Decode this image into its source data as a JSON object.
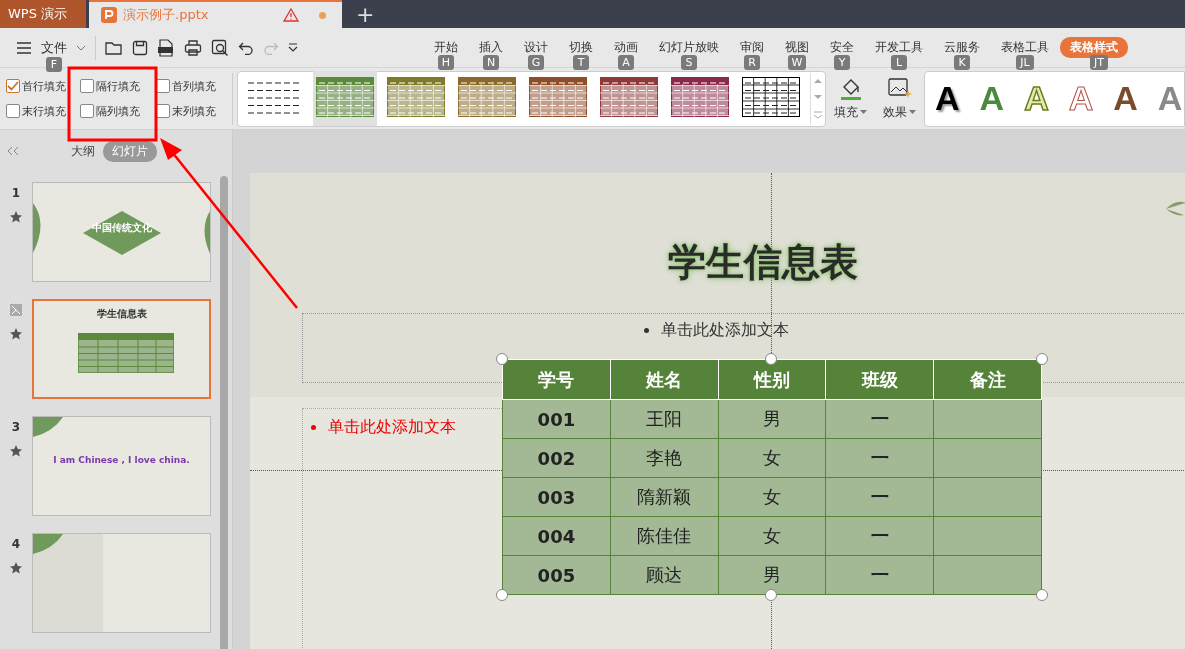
{
  "tabs": [
    {
      "label": "WPS 演示",
      "kind": "app",
      "selected": false
    },
    {
      "label": "演示例子.pptx",
      "kind": "doc",
      "selected": true
    }
  ],
  "new_tab": "+",
  "file_menu": {
    "label": "文件",
    "keytip": "F"
  },
  "ribbon_tabs": [
    {
      "label": "开始",
      "keytip": "H",
      "selected": false
    },
    {
      "label": "插入",
      "keytip": "N",
      "selected": false
    },
    {
      "label": "设计",
      "keytip": "G",
      "selected": false
    },
    {
      "label": "切换",
      "keytip": "T",
      "selected": false
    },
    {
      "label": "动画",
      "keytip": "A",
      "selected": false
    },
    {
      "label": "幻灯片放映",
      "keytip": "S",
      "selected": false
    },
    {
      "label": "审阅",
      "keytip": "R",
      "selected": false
    },
    {
      "label": "视图",
      "keytip": "W",
      "selected": false
    },
    {
      "label": "安全",
      "keytip": "Y",
      "selected": false
    },
    {
      "label": "开发工具",
      "keytip": "L",
      "selected": false
    },
    {
      "label": "云服务",
      "keytip": "K",
      "selected": false
    },
    {
      "label": "表格工具",
      "keytip": "JL",
      "selected": false
    },
    {
      "label": "表格样式",
      "keytip": "JT",
      "selected": true
    }
  ],
  "table_options": [
    {
      "label": "首行填充",
      "checked": true
    },
    {
      "label": "隔行填充",
      "checked": false
    },
    {
      "label": "首列填充",
      "checked": false
    },
    {
      "label": "末行填充",
      "checked": false
    },
    {
      "label": "隔列填充",
      "checked": false
    },
    {
      "label": "末列填充",
      "checked": false
    }
  ],
  "table_styles": [
    {
      "kind": "plain",
      "selected": false
    },
    {
      "kind": "filled",
      "color": "#5b8a3a",
      "selected": true
    },
    {
      "kind": "filled",
      "color": "#7d7a2a",
      "selected": false
    },
    {
      "kind": "filled",
      "color": "#8a6a2a",
      "selected": false
    },
    {
      "kind": "filled",
      "color": "#8f4e2a",
      "selected": false
    },
    {
      "kind": "filled",
      "color": "#8f3a3a",
      "selected": false
    },
    {
      "kind": "filled",
      "color": "#8a2a4a",
      "selected": false
    },
    {
      "kind": "grid",
      "selected": false
    }
  ],
  "fill_button": "填充",
  "effect_button": "效果",
  "text_styles": [
    {
      "label": "A",
      "kind": "shadow"
    },
    {
      "label": "A",
      "kind": "green"
    },
    {
      "label": "A",
      "kind": "olive-outline"
    },
    {
      "label": "A",
      "kind": "red-outline"
    },
    {
      "label": "A",
      "kind": "brown"
    },
    {
      "label": "A",
      "kind": "gradient"
    }
  ],
  "panel_tabs": [
    {
      "label": "大纲",
      "selected": false
    },
    {
      "label": "幻灯片",
      "selected": true
    }
  ],
  "slides": [
    {
      "number": "1",
      "kind": "title",
      "title": "中国传统文化",
      "selected": false
    },
    {
      "kind": "table",
      "title": "学生信息表",
      "selected": true
    },
    {
      "number": "3",
      "kind": "text",
      "title": "I am Chinese , I love china.",
      "selected": false
    },
    {
      "number": "4",
      "kind": "blank",
      "selected": false
    }
  ],
  "slide": {
    "title": "学生信息表",
    "subtitle": "单击此处添加文本",
    "body": "单击此处添加文本",
    "table": {
      "columns": [
        "学号",
        "姓名",
        "性别",
        "班级",
        "备注"
      ],
      "rows": [
        [
          "001",
          "王阳",
          "男",
          "一"
        ],
        [
          "002",
          "李艳",
          "女",
          "一"
        ],
        [
          "003",
          "隋新颖",
          "女",
          "一"
        ],
        [
          "004",
          "陈佳佳",
          "女",
          "一"
        ],
        [
          "005",
          "顾达",
          "男",
          "一"
        ]
      ]
    }
  }
}
